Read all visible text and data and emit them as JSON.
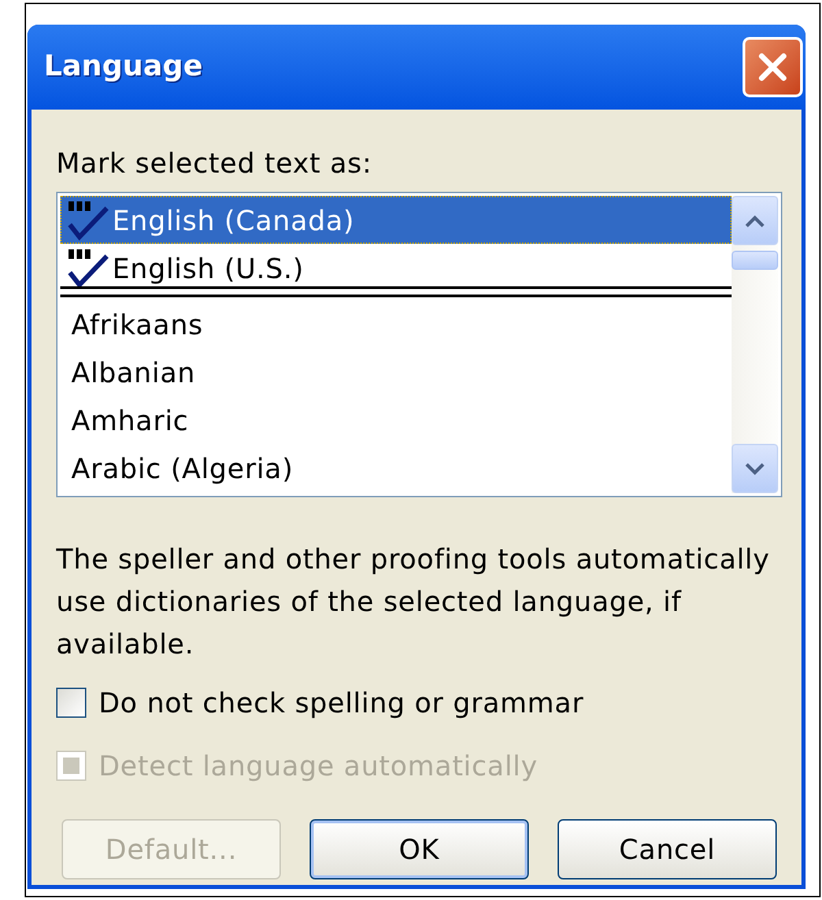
{
  "window": {
    "title": "Language"
  },
  "list_label": "Mark selected text as:",
  "languages": [
    {
      "label": "English (Canada)",
      "proofing": true,
      "selected": true,
      "separator_after": false
    },
    {
      "label": "English (U.S.)",
      "proofing": true,
      "selected": false,
      "separator_after": true
    },
    {
      "label": "Afrikaans",
      "proofing": false,
      "selected": false,
      "separator_after": false
    },
    {
      "label": "Albanian",
      "proofing": false,
      "selected": false,
      "separator_after": false
    },
    {
      "label": "Amharic",
      "proofing": false,
      "selected": false,
      "separator_after": false
    },
    {
      "label": "Arabic (Algeria)",
      "proofing": false,
      "selected": false,
      "separator_after": false
    }
  ],
  "description": "The speller and other proofing tools automatically use dictionaries of the selected language, if available.",
  "checkboxes": [
    {
      "label": "Do not check spelling or grammar",
      "checked": false,
      "indeterminate": false,
      "disabled": false
    },
    {
      "label": "Detect language automatically",
      "checked": false,
      "indeterminate": true,
      "disabled": true
    }
  ],
  "buttons": [
    {
      "label": "Default...",
      "disabled": true,
      "default": false
    },
    {
      "label": "OK",
      "disabled": false,
      "default": true
    },
    {
      "label": "Cancel",
      "disabled": false,
      "default": false
    }
  ]
}
